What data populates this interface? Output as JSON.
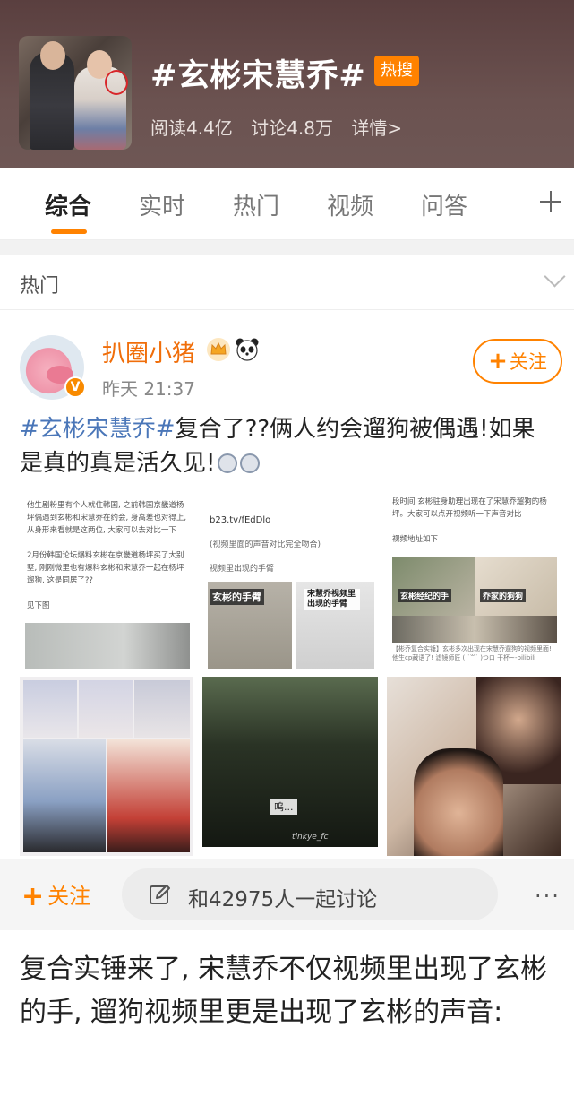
{
  "topic": {
    "title": "#玄彬宋慧乔#",
    "badge": "热搜",
    "reads": "阅读4.4亿",
    "discussions": "讨论4.8万",
    "details": "详情>"
  },
  "tabs": [
    {
      "label": "综合",
      "active": true
    },
    {
      "label": "实时",
      "active": false
    },
    {
      "label": "热门",
      "active": false
    },
    {
      "label": "视频",
      "active": false
    },
    {
      "label": "问答",
      "active": false
    }
  ],
  "section": {
    "title": "热门"
  },
  "post": {
    "user_name": "扒圈小猪",
    "badge": "V",
    "time": "昨天 21:37",
    "follow_label": "关注",
    "hashtag": "#玄彬宋慧乔#",
    "text": "复合了??俩人约会遛狗被偶遇!如果是真的真是活久见!",
    "images": {
      "doc1": {
        "para1": "他生剧粉里有个人就住韩国, 之前韩国京畿道杨坪偶遇到玄彬和宋慧乔在约会, 身高差也对得上, 从身形来看就是这两位, 大家可以去对比一下",
        "para2": "2月份韩国论坛爆料玄彬在京畿道杨坪买了大别墅, 刚刚微里也有爆料玄彬和宋慧乔一起在杨坪遛狗, 这是同居了??",
        "see_below": "见下图"
      },
      "doc2": {
        "link": "b23.tv/fEdDlo",
        "note": "(视频里面的声音对比完全吻合)",
        "caption_line": "视频里出现的手臂",
        "label_left": "玄彬的手臂",
        "label_right": "宋慧乔视频里 出现的手臂"
      },
      "doc3": {
        "para": "段时间 玄彬驻身助理出现在了宋慧乔遛狗的杨坪。大家可以点开视频听一下声音对比",
        "video_addr": "视频地址如下",
        "label_left": "玄彬经纪的手",
        "label_right": "乔家的狗狗",
        "footer": "【彬乔复合实锤】玄彬多次出现在宋慧乔遛狗的视频里面! 他生cp藏语了! 滤镜师匠 ( ˙꒳˙ )つロ 干杯~-bilibili"
      },
      "video_caption": "呜...",
      "watermark": "tinkye_fc"
    }
  },
  "bottom_bar": {
    "follow_label": "关注",
    "discuss_text": "和42975人一起讨论",
    "more": "···"
  },
  "article": {
    "text": "复合实锤来了, 宋慧乔不仅视频里出现了玄彬的手, 遛狗视频里更是出现了玄彬的声音:"
  },
  "colors": {
    "accent": "#ff8200",
    "hashtag": "#4a76b8",
    "username": "#f06e0a"
  }
}
